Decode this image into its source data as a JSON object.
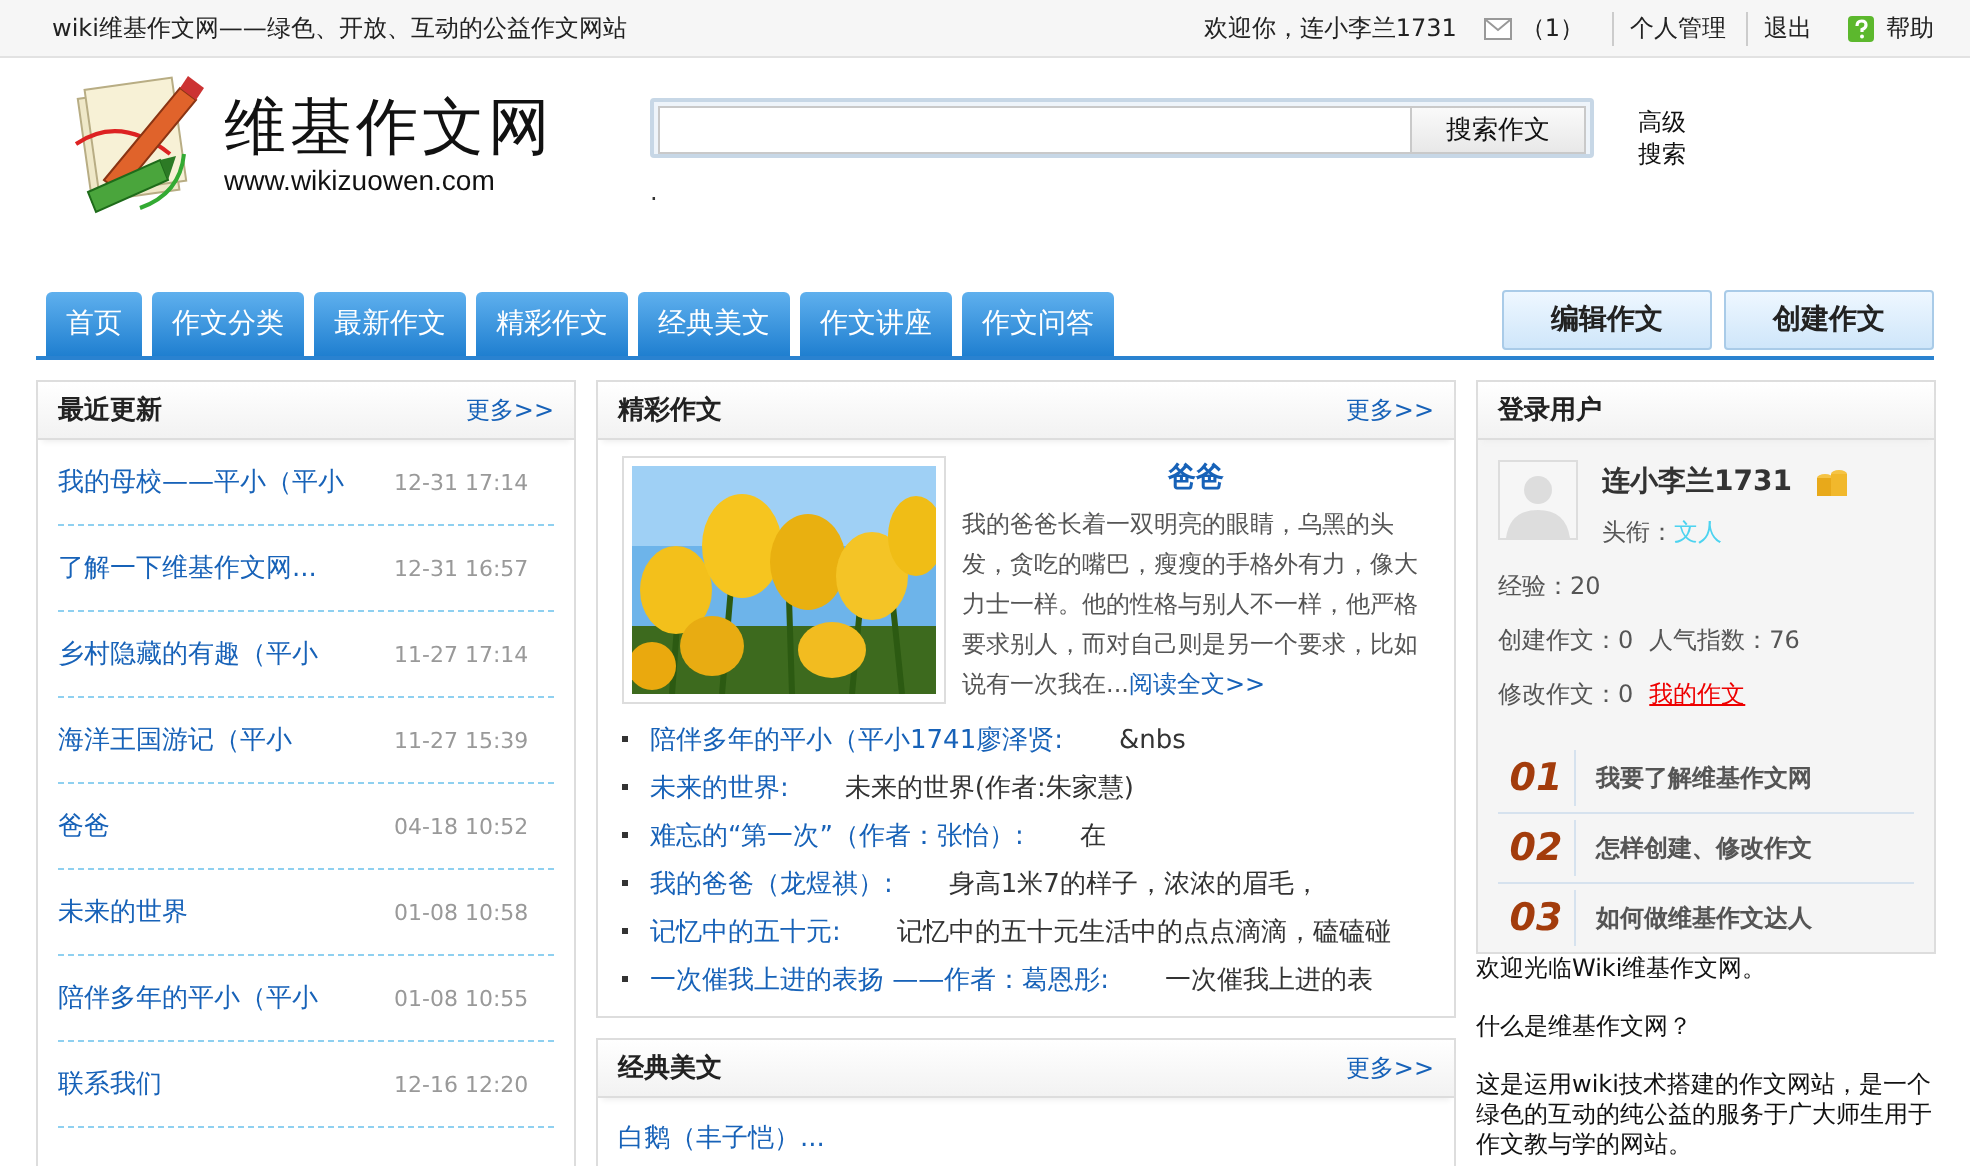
{
  "top_bar": {
    "slogan": "wiki维基作文网——绿色、开放、互动的公益作文网站",
    "welcome": "欢迎你，连小李兰1731",
    "messages": "（1）",
    "links": [
      {
        "label": "个人管理",
        "kind": "text"
      },
      {
        "label": "退出",
        "kind": "text"
      },
      {
        "label": "帮助",
        "kind": "help"
      }
    ]
  },
  "header": {
    "logo_title": "维基作文网",
    "logo_url": "www.wikizuowen.com",
    "search_button": "搜索作文",
    "advanced_search": "高级搜索",
    "note": "."
  },
  "nav": {
    "tabs": [
      {
        "label": "首页",
        "selected": false
      },
      {
        "label": "作文分类",
        "selected": false
      },
      {
        "label": "最新作文",
        "selected": false
      },
      {
        "label": "精彩作文",
        "selected": false
      },
      {
        "label": "经典美文",
        "selected": false
      },
      {
        "label": "作文讲座",
        "selected": false
      },
      {
        "label": "作文问答",
        "selected": false
      }
    ],
    "actions": [
      "编辑作文",
      "创建作文"
    ]
  },
  "recent": {
    "title": "最近更新",
    "more": "更多>>",
    "items": [
      {
        "title": "我的母校——平小（平小",
        "time": "12-31 17:14"
      },
      {
        "title": "了解一下维基作文网...",
        "time": "12-31 16:57"
      },
      {
        "title": "乡村隐藏的有趣（平小",
        "time": "11-27 17:14"
      },
      {
        "title": "海洋王国游记（平小",
        "time": "11-27 15:39"
      },
      {
        "title": "爸爸",
        "time": "04-18 10:52"
      },
      {
        "title": "未来的世界",
        "time": "01-08 10:58"
      },
      {
        "title": "陪伴多年的平小（平小",
        "time": "01-08 10:55"
      },
      {
        "title": "联系我们",
        "time": "12-16 12:20"
      }
    ]
  },
  "featured": {
    "title": "精彩作文",
    "more": "更多>>",
    "lead": {
      "title": "爸爸",
      "excerpt": "我的爸爸长着一双明亮的眼睛，乌黑的头发，贪吃的嘴巴，瘦瘦的手格外有力，像大力士一样。他的性格与别人不一样，他严格要求别人，而对自己则是另一个要求，比如说有一次我在...",
      "read_more": "阅读全文>>"
    },
    "items": [
      {
        "link": "陪伴多年的平小（平小1741廖泽贤:",
        "text": "&nbs"
      },
      {
        "link": "未来的世界:",
        "text": "未来的世界(作者:朱家慧)"
      },
      {
        "link": "难忘的“第一次”（作者：张怡）:",
        "text": "在"
      },
      {
        "link": "我的爸爸（龙煜祺）:",
        "text": "身高1米7的样子，浓浓的眉毛，"
      },
      {
        "link": "记忆中的五十元:",
        "text": "记忆中的五十元生活中的点点滴滴，磕磕碰"
      },
      {
        "link": "一次催我上进的表扬 ——作者：葛恩彤:",
        "text": "一次催我上进的表"
      }
    ]
  },
  "classic": {
    "title": "经典美文",
    "more": "更多>>",
    "items": [
      "白鹅（丰子恺）..."
    ]
  },
  "user_panel": {
    "title": "登录用户",
    "name": "连小李兰1731",
    "rank_label": "头衔：",
    "rank": "文人",
    "experience": "经验：20",
    "created": "创建作文：0",
    "popularity": "人气指数：76",
    "edited": "修改作文：0",
    "my_works": "我的作文",
    "guides": [
      {
        "number": "01",
        "label": "我要了解维基作文网"
      },
      {
        "number": "02",
        "label": "怎样创建、修改作文"
      },
      {
        "number": "03",
        "label": "如何做维基作文达人"
      }
    ]
  },
  "about": [
    "欢迎光临Wiki维基作文网。",
    "什么是维基作文网？",
    "这是运用wiki技术搭建的作文网站，是一个绿色的互动的纯公益的服务于广大师生用于作文教与学的网站。"
  ]
}
